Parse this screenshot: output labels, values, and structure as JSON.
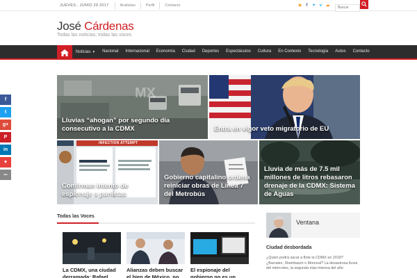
{
  "topbar": {
    "date": "Jueves , junio 29 2017",
    "links": [
      "Analistas",
      "Perfil",
      "Contacto"
    ],
    "search_placeholder": "Buscar"
  },
  "header": {
    "title_first": "José",
    "title_second": "Cárdenas",
    "tagline": "Todas las noticias; todas las voces"
  },
  "nav": {
    "items": [
      "Noticias",
      "Nacional",
      "Internacional",
      "Economía",
      "Ciudad",
      "Deportes",
      "Espectáculos",
      "Cultura",
      "En Contexto",
      "Tecnología",
      "Autos",
      "Contacto"
    ]
  },
  "featured": [
    {
      "title": "Lluvias “ahogan” por segundo día consecutivo a la CDMX"
    },
    {
      "title": "Entra en vigor veto migratorio de EU"
    },
    {
      "title": "Confirman intento de espionaje a panistas",
      "overlay_text": "INFECTION ATTEMPT"
    },
    {
      "title": "Gobierno capitalino ordena reiniciar obras de Línea 7 del Metrobús"
    },
    {
      "title": "Lluvia de más de 7.5 mil millones de litros rebasaron drenaje de la CDMX: Sistema de Aguas"
    }
  ],
  "voces": {
    "heading": "Todas las Voces",
    "cards": [
      {
        "title": "La CDMX, una ciudad derramada: Rafael"
      },
      {
        "title": "Alianzas deben buscar el bien de México, no"
      },
      {
        "title": "El espionaje del gobierno no es un"
      }
    ]
  },
  "sidebar": {
    "widget_title": "Ventana",
    "post_title": "Ciudad desbordada",
    "post_excerpt": "¿Quien podrá sacar a flote la CDMX en 2018? ¿Barrales, Sheinbaum o Monreal? La desastrosa lluvia del miércoles, la segunda más intensa del año"
  },
  "share": [
    "f",
    "t",
    "g+",
    "P",
    "in",
    "♥",
    "•••"
  ],
  "colors": {
    "accent": "#d01f25",
    "nav_bg": "#2d2d2d",
    "facebook": "#3b5998",
    "twitter": "#1da1f2",
    "googleplus": "#dd4b39",
    "pinterest": "#cb2027",
    "linkedin": "#0077b5",
    "love": "#e8403c",
    "more": "#888888"
  }
}
